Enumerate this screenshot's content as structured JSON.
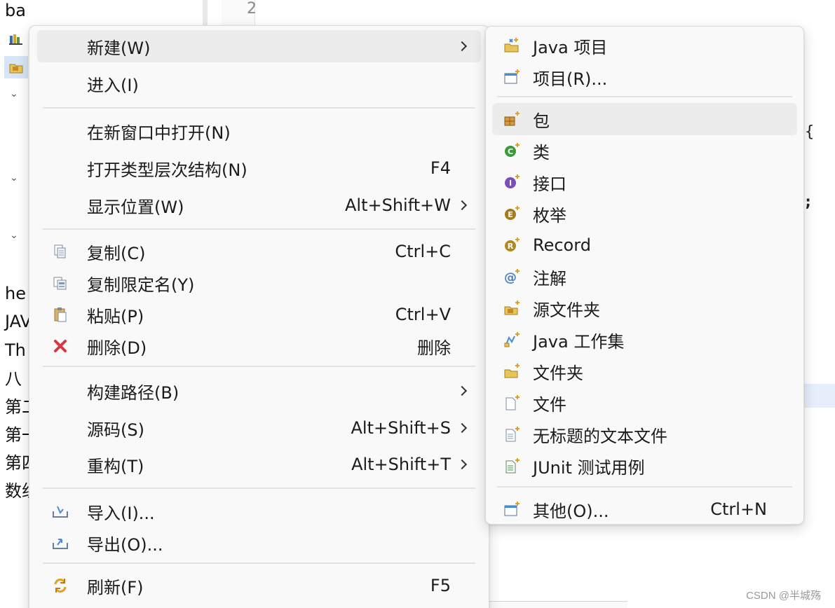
{
  "explorer": {
    "top_text": "ba",
    "lower_items": [
      "he",
      "JAV",
      "Th",
      "八",
      "第二",
      "第一",
      "第四",
      "数组"
    ]
  },
  "editor": {
    "line_number": "2",
    "code_brace": "{",
    "code_semicolon": ";"
  },
  "context_menu": {
    "new": {
      "label": "新建(W)",
      "has_submenu": true
    },
    "go_into": {
      "label": "进入(I)"
    },
    "open_new_window": {
      "label": "在新窗口中打开(N)"
    },
    "open_type_hierarchy": {
      "label": "打开类型层次结构(N)",
      "shortcut": "F4"
    },
    "show_in": {
      "label": "显示位置(W)",
      "shortcut": "Alt+Shift+W",
      "has_submenu": true
    },
    "copy": {
      "label": "复制(C)",
      "shortcut": "Ctrl+C"
    },
    "copy_qualified": {
      "label": "复制限定名(Y)"
    },
    "paste": {
      "label": "粘贴(P)",
      "shortcut": "Ctrl+V"
    },
    "delete": {
      "label": "删除(D)",
      "shortcut": "删除"
    },
    "build_path": {
      "label": "构建路径(B)",
      "has_submenu": true
    },
    "source": {
      "label": "源码(S)",
      "shortcut": "Alt+Shift+S",
      "has_submenu": true
    },
    "refactor": {
      "label": "重构(T)",
      "shortcut": "Alt+Shift+T",
      "has_submenu": true
    },
    "import": {
      "label": "导入(I)..."
    },
    "export": {
      "label": "导出(O)..."
    },
    "refresh": {
      "label": "刷新(F)",
      "shortcut": "F5"
    }
  },
  "submenu": {
    "java_project": {
      "label": "Java 项目"
    },
    "project": {
      "label": "项目(R)..."
    },
    "package": {
      "label": "包"
    },
    "class": {
      "label": "类"
    },
    "interface": {
      "label": "接口"
    },
    "enum": {
      "label": "枚举"
    },
    "record": {
      "label": "Record"
    },
    "annotation": {
      "label": "注解"
    },
    "source_folder": {
      "label": "源文件夹"
    },
    "java_working_set": {
      "label": "Java 工作集"
    },
    "folder": {
      "label": "文件夹"
    },
    "file": {
      "label": "文件"
    },
    "untitled_text_file": {
      "label": "无标题的文本文件"
    },
    "junit_test_case": {
      "label": "JUnit 测试用例"
    },
    "other": {
      "label": "其他(O)...",
      "shortcut": "Ctrl+N"
    }
  },
  "watermark": "CSDN @半城殇",
  "colors": {
    "menu_bg": "#f9f9f9",
    "hover_bg": "#ececec",
    "class_green": "#3c9a3c",
    "interface_purple": "#7a4fb5",
    "enum_brown": "#b08a1e",
    "delete_red": "#d9363e",
    "folder_yellow": "#e8c45a"
  }
}
